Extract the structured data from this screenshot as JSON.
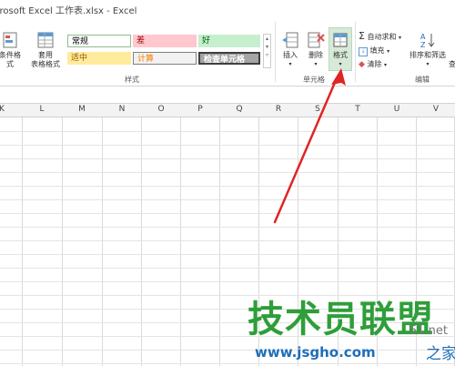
{
  "window": {
    "title": "crosoft Excel 工作表.xlsx - Excel"
  },
  "ribbon": {
    "conditional_format_label": "条件格式",
    "table_format_label_1": "套用",
    "table_format_label_2": "表格格式",
    "styles_group_label": "样式",
    "cells_group_label": "单元格",
    "editing_group_label": "编辑",
    "styles": {
      "normal": "常规",
      "bad": "差",
      "good": "好",
      "neutral": "适中",
      "calculation": "计算",
      "check_cell": "检查单元格"
    },
    "insert_label": "插入",
    "delete_label": "删除",
    "format_label": "格式",
    "autosum_label": "自动求和",
    "fill_label": "填充",
    "clear_label": "清除",
    "sort_filter_label": "排序和筛选",
    "find_select_label": "查"
  },
  "columns": [
    "K",
    "L",
    "M",
    "N",
    "O",
    "P",
    "Q",
    "R",
    "S",
    "T",
    "U",
    "V"
  ],
  "watermark": {
    "main": "技术员联盟",
    "url": "www.jsgho.com",
    "right_small": "51.net",
    "right_large": "之家"
  },
  "colors": {
    "accent_green": "#217346",
    "arrow_red": "#e02424",
    "style_bad_bg": "#ffc7ce",
    "style_good_bg": "#c6efce",
    "style_neutral_bg": "#ffeb9c",
    "watermark_green": "#2f9e3a",
    "watermark_blue": "#1f6fb8"
  }
}
